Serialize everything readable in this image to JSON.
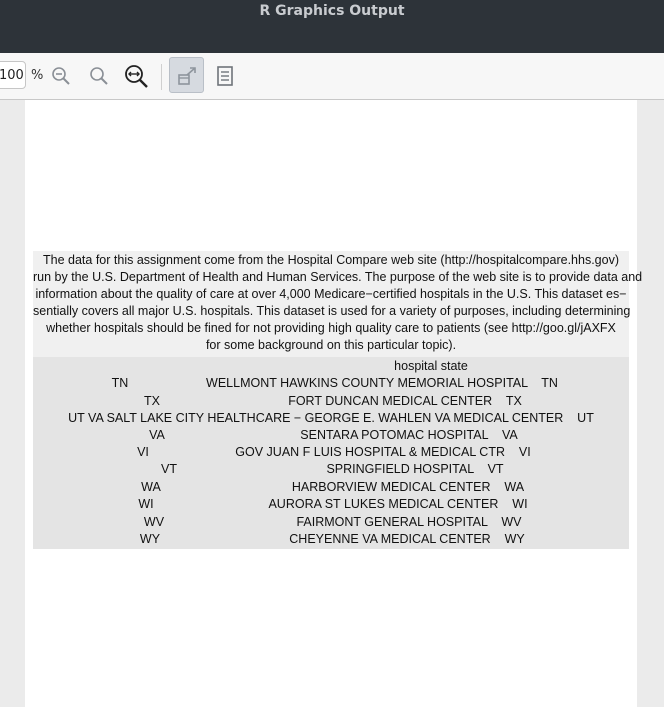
{
  "window": {
    "title": "R Graphics Output"
  },
  "toolbar": {
    "zoom_value": "100",
    "zoom_unit": "%",
    "icons": [
      "zoom-out-icon",
      "zoom-in-icon",
      "zoom-fit-icon",
      "expand-icon",
      "document-icon"
    ]
  },
  "intro_lines": [
    "The data for this assignment come from the Hospital Compare web site (http://hospitalcompare.hhs.gov)",
    "run by the U.S. Department of Health and Human Services. The purpose of the web site is to provide data and",
    "information about the quality of care at over 4,000 Medicare−certified hospitals in the U.S. This dataset es−",
    "sentially covers all major U.S. hospitals. This dataset is used for a variety of purposes, including determining",
    "whether hospitals should be fined for not providing high quality care to patients (see http://goo.gl/jAXFX",
    "for some background on this particular topic)."
  ],
  "table": {
    "header": "hospital state",
    "rows": [
      {
        "rowname": "TN",
        "text": "WELLMONT HAWKINS COUNTY MEMORIAL HOSPITAL    TN"
      },
      {
        "rowname": "TX",
        "text": "FORT DUNCAN MEDICAL CENTER    TX"
      },
      {
        "rowname": "",
        "text": "UT VA SALT LAKE CITY HEALTHCARE − GEORGE E. WAHLEN VA MEDICAL CENTER    UT"
      },
      {
        "rowname": "VA",
        "text": "SENTARA POTOMAC HOSPITAL    VA"
      },
      {
        "rowname": "VI",
        "text": "GOV JUAN F LUIS HOSPITAL & MEDICAL CTR    VI"
      },
      {
        "rowname": "VT",
        "text": "SPRINGFIELD HOSPITAL    VT"
      },
      {
        "rowname": "WA",
        "text": "HARBORVIEW MEDICAL CENTER    WA"
      },
      {
        "rowname": "WI",
        "text": "AURORA ST LUKES MEDICAL CENTER    WI"
      },
      {
        "rowname": "WV",
        "text": "FAIRMONT GENERAL HOSPITAL    WV"
      },
      {
        "rowname": "WY",
        "text": "CHEYENNE VA MEDICAL CENTER    WY"
      }
    ]
  }
}
